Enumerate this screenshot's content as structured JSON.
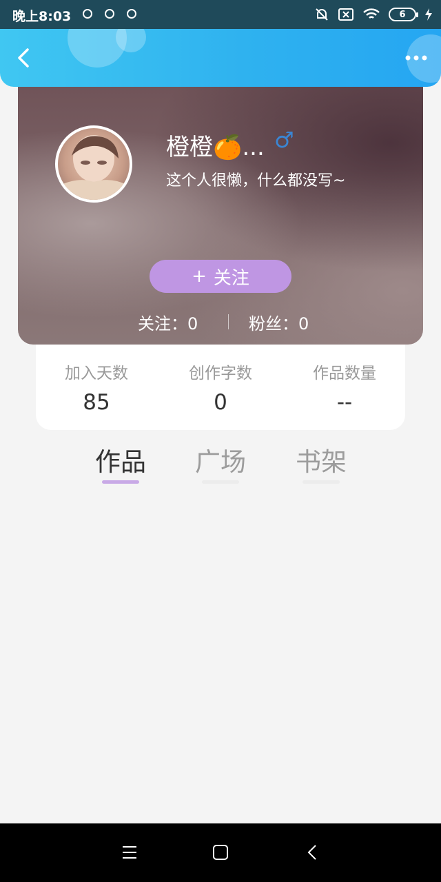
{
  "status_bar": {
    "time": "晚上8:03",
    "battery_level": "6"
  },
  "profile": {
    "name": "橙橙🍊...",
    "gender_symbol": "♂",
    "bio": "这个人很懒，什么都没写~",
    "follow_button": {
      "plus": "+",
      "label": "关注"
    },
    "following": "关注：0",
    "fans": "粉丝：0"
  },
  "stats": [
    {
      "label": "加入天数",
      "value": "85"
    },
    {
      "label": "创作字数",
      "value": "0"
    },
    {
      "label": "作品数量",
      "value": "--"
    }
  ],
  "tabs": [
    {
      "label": "作品",
      "active": true
    },
    {
      "label": "广场",
      "active": false
    },
    {
      "label": "书架",
      "active": false
    }
  ],
  "colors": {
    "header_blue": "#2fb2ef",
    "follow_button": "#bf96e3",
    "tab_indicator_active": "#c8a9e6",
    "tab_indicator_inactive": "#ececec",
    "gender_icon": "#3a86d4"
  },
  "icons": {
    "back": "chevron-left-icon",
    "more": "more-dots-icon",
    "gender": "male-icon",
    "nav_menu": "menu-icon",
    "nav_home": "home-square-icon",
    "nav_back": "nav-back-icon"
  }
}
